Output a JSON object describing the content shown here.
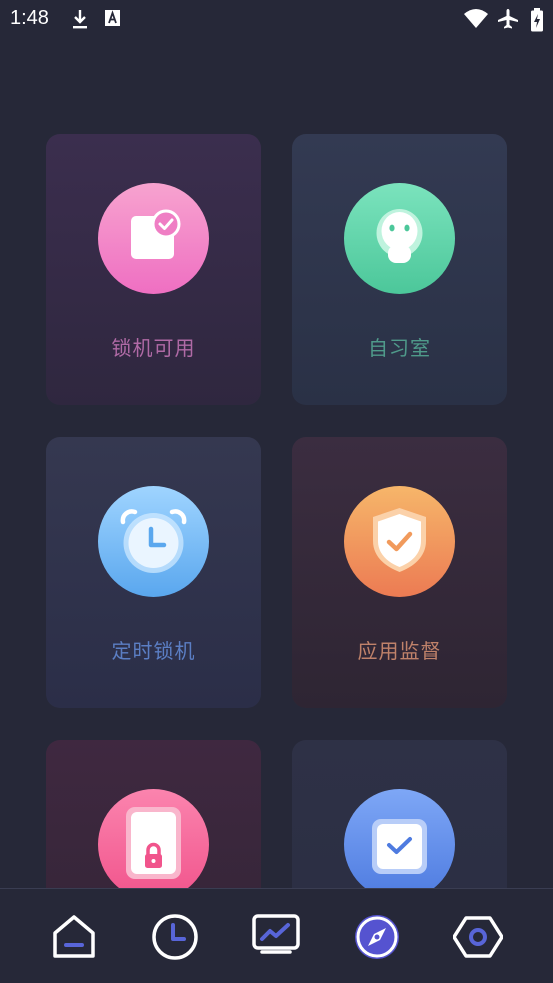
{
  "status_bar": {
    "time": "1:48",
    "icons": [
      "download-icon",
      "font-a-icon",
      "wifi-icon",
      "airplane-icon",
      "battery-charging-icon"
    ]
  },
  "cards": [
    {
      "label": "锁机可用",
      "icon": "note-check-icon",
      "label_color": "#b06aa6"
    },
    {
      "label": "自习室",
      "icon": "student-icon",
      "label_color": "#4f9a8a"
    },
    {
      "label": "定时锁机",
      "icon": "alarm-clock-icon",
      "label_color": "#5b7ec4"
    },
    {
      "label": "应用监督",
      "icon": "shield-check-icon",
      "label_color": "#c0826a"
    },
    {
      "label": "",
      "icon": "phone-lock-icon",
      "label_color": "#c25d80"
    },
    {
      "label": "",
      "icon": "checkbox-icon",
      "label_color": "#6d8ac8"
    }
  ],
  "bottom_nav": {
    "items": [
      "home-icon",
      "clock-icon",
      "trend-monitor-icon",
      "compass-icon",
      "hexagon-settings-icon"
    ],
    "active": "compass-icon"
  }
}
